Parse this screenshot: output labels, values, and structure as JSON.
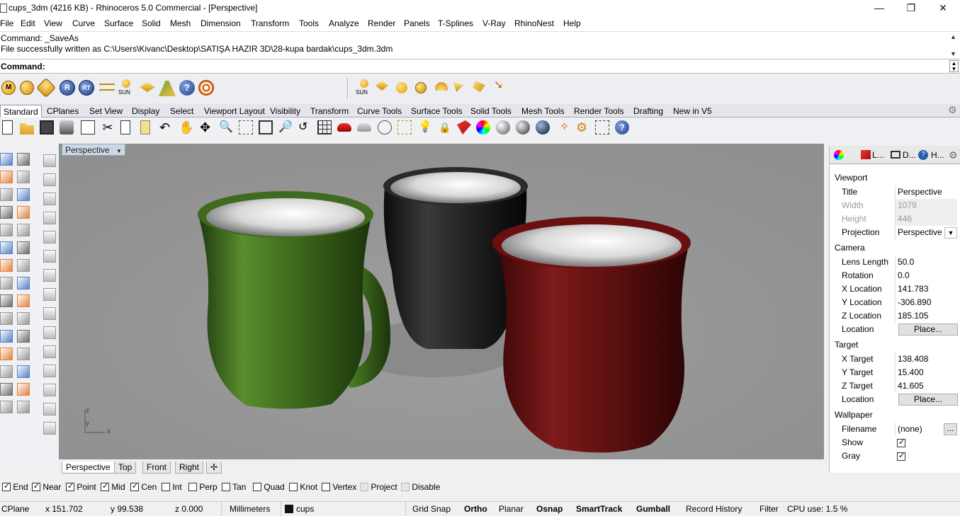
{
  "window": {
    "title": "cups_3dm (4216 KB) - Rhinoceros 5.0 Commercial - [Perspective]",
    "minimize": "—",
    "maximize": "❐",
    "close": "✕"
  },
  "menu": [
    "File",
    "Edit",
    "View",
    "Curve",
    "Surface",
    "Solid",
    "Mesh",
    "Dimension",
    "Transform",
    "Tools",
    "Analyze",
    "Render",
    "Panels",
    "T-Splines",
    "V-Ray",
    "RhinoNest",
    "Help"
  ],
  "command": {
    "history": [
      "Command: _SaveAs",
      "File successfully written as C:\\Users\\Kivanc\\Desktop\\SATIŞA HAZIR 3D\\28-kupa bardak\\cups_3dm.3dm"
    ],
    "prompt": "Command:",
    "input_value": ""
  },
  "render_toolbar": {
    "sun_label": "SUN",
    "sun_label2": "SUN"
  },
  "toolbar_tabs": [
    "Standard",
    "CPlanes",
    "Set View",
    "Display",
    "Select",
    "Viewport Layout",
    "Visibility",
    "Transform",
    "Curve Tools",
    "Surface Tools",
    "Solid Tools",
    "Mesh Tools",
    "Render Tools",
    "Drafting",
    "New in V5"
  ],
  "viewport": {
    "title": "Perspective",
    "axis_z": "z",
    "axis_y": "y",
    "axis_x": "x",
    "tabs": [
      "Perspective",
      "Top",
      "Front",
      "Right"
    ],
    "add_tab": "✢"
  },
  "panel": {
    "tab_labels": [
      "L...",
      "D...",
      "H..."
    ],
    "sections": {
      "viewport": "Viewport",
      "camera": "Camera",
      "target": "Target",
      "wallpaper": "Wallpaper"
    },
    "viewport_rows": [
      {
        "k": "Title",
        "v": "Perspective"
      },
      {
        "k": "Width",
        "v": "1079"
      },
      {
        "k": "Height",
        "v": "446"
      },
      {
        "k": "Projection",
        "v": "Perspective"
      }
    ],
    "camera_rows": [
      {
        "k": "Lens Length",
        "v": "50.0"
      },
      {
        "k": "Rotation",
        "v": "0.0"
      },
      {
        "k": "X Location",
        "v": "141.783"
      },
      {
        "k": "Y Location",
        "v": "-306.890"
      },
      {
        "k": "Z Location",
        "v": "185.105"
      },
      {
        "k": "Location",
        "v": "Place..."
      }
    ],
    "target_rows": [
      {
        "k": "X Target",
        "v": "138.408"
      },
      {
        "k": "Y Target",
        "v": "15.400"
      },
      {
        "k": "Z Target",
        "v": "41.605"
      },
      {
        "k": "Location",
        "v": "Place..."
      }
    ],
    "wallpaper_rows": [
      {
        "k": "Filename",
        "v": "(none)"
      },
      {
        "k": "Show",
        "v": ""
      },
      {
        "k": "Gray",
        "v": ""
      }
    ],
    "browse_label": "..."
  },
  "osnaps": [
    {
      "label": "End",
      "on": true
    },
    {
      "label": "Near",
      "on": true
    },
    {
      "label": "Point",
      "on": true
    },
    {
      "label": "Mid",
      "on": true
    },
    {
      "label": "Cen",
      "on": true
    },
    {
      "label": "Int",
      "on": false
    },
    {
      "label": "Perp",
      "on": false
    },
    {
      "label": "Tan",
      "on": false
    },
    {
      "label": "Quad",
      "on": false
    },
    {
      "label": "Knot",
      "on": false
    },
    {
      "label": "Vertex",
      "on": false
    },
    {
      "label": "Project",
      "on": false
    },
    {
      "label": "Disable",
      "on": false
    }
  ],
  "status": {
    "cplane": "CPlane",
    "x": "x 151.702",
    "y": "y 99.538",
    "z": "z 0.000",
    "units": "Millimeters",
    "layer": "cups",
    "grid_snap": "Grid Snap",
    "ortho": "Ortho",
    "planar": "Planar",
    "osnap": "Osnap",
    "smarttrack": "SmartTrack",
    "gumball": "Gumball",
    "record_history": "Record History",
    "filter": "Filter",
    "cpu": "CPU use: 1.5 %"
  },
  "colors": {
    "green_cup": "#3e6a20",
    "black_cup": "#1f1f1f",
    "red_cup": "#6e1414",
    "viewport_bg": "#9a9a9a"
  }
}
